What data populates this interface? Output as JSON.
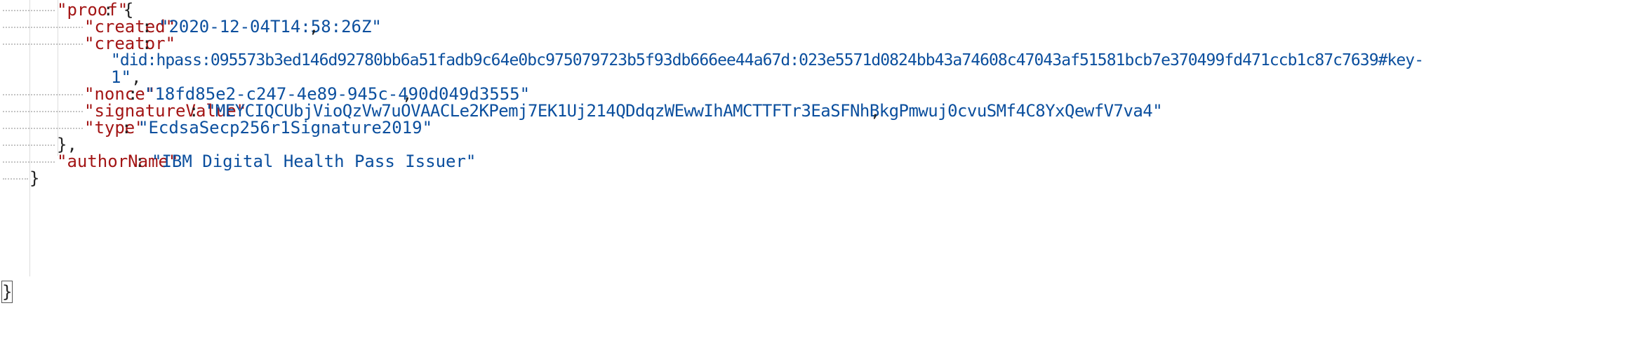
{
  "json_view": {
    "proof": {
      "key": "\"proof\"",
      "sep": ": {",
      "created": {
        "key": "\"created\"",
        "sep": ": ",
        "value": "\"2020-12-04T14:58:26Z\"",
        "end": ","
      },
      "creator": {
        "key": "\"creator\"",
        "sep": ":",
        "value_line1": "\"did:hpass:095573b3ed146d92780bb6a51fadb9c64e0bc975079723b5f93db666ee44a67d:023e5571d0824bb43a74608c47043af51581bcb7e370499fd471ccb1c87c7639#key-",
        "value_line2": "1\"",
        "end": ","
      },
      "nonce": {
        "key": "\"nonce\"",
        "sep": ": ",
        "value": "\"18fd85e2-c247-4e89-945c-490d049d3555\"",
        "end": ","
      },
      "signatureValue": {
        "key": "\"signatureValue\"",
        "sep": ": ",
        "value": "\"MEYCIQCUbjVioQzVw7uOVAACLe2KPemj7EK1Uj214QDdqzWEwwIhAMCTTFTr3EaSFNhBkgPmwuj0cvuSMf4C8YxQewfV7va4\"",
        "end": ","
      },
      "type": {
        "key": "\"type\"",
        "sep": ": ",
        "value": "\"EcdsaSecp256r1Signature2019\""
      },
      "close": "},"
    },
    "authorName": {
      "key": "\"authorName\"",
      "sep": ": ",
      "value": "\"IBM Digital Health Pass Issuer\""
    },
    "inner_close": "}",
    "outer_close": "}"
  }
}
